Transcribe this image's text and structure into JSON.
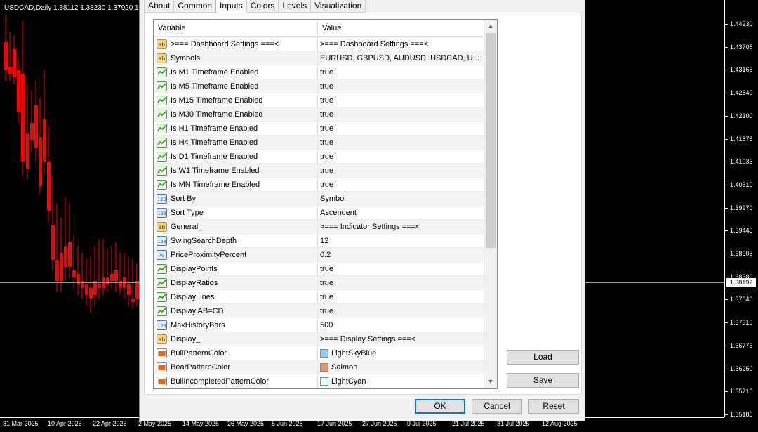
{
  "chart": {
    "header": "USDCAD,Daily  1.38112 1.38230 1.37920 1.",
    "current_price": "1.38192",
    "price_labels": [
      "1.44230",
      "1.43705",
      "1.43165",
      "1.42640",
      "1.42100",
      "1.41575",
      "1.41035",
      "1.40510",
      "1.39970",
      "1.39445",
      "1.38905",
      "1.38380",
      "1.37840",
      "1.37315",
      "1.36775",
      "1.36250",
      "1.35710",
      "1.35185"
    ],
    "date_labels": [
      "31 Mar 2025",
      "10 Apr 2025",
      "22 Apr 2025",
      "2 May 2025",
      "14 May 2025",
      "26 May 2025",
      "5 Jun 2025",
      "17 Jun 2025",
      "27 Jun 2025",
      "9 Jul 2025",
      "21 Jul 2025",
      "31 Jul 2025",
      "12 Aug 2025"
    ],
    "bull_color": "#00ff00",
    "bear_color": "#ff0000"
  },
  "dialog": {
    "tabs": [
      {
        "label": "About"
      },
      {
        "label": "Common"
      },
      {
        "label": "Inputs",
        "active": true
      },
      {
        "label": "Colors"
      },
      {
        "label": "Levels"
      },
      {
        "label": "Visualization"
      }
    ],
    "grid": {
      "columns": {
        "variable": "Variable",
        "value": "Value"
      },
      "rows": [
        {
          "icon": "ab",
          "variable": ">=== Dashboard Settings ===<",
          "value": ">=== Dashboard Settings ===<"
        },
        {
          "icon": "ab",
          "variable": "Symbols",
          "value": "EURUSD, GBPUSD, AUDUSD, USDCAD, U..."
        },
        {
          "icon": "bool",
          "variable": "Is M1 Timeframe Enabled",
          "value": "true"
        },
        {
          "icon": "bool",
          "variable": "Is M5 Timeframe Enabled",
          "value": "true"
        },
        {
          "icon": "bool",
          "variable": "Is M15 Timeframe Enabled",
          "value": "true"
        },
        {
          "icon": "bool",
          "variable": "Is M30 Timeframe Enabled",
          "value": "true"
        },
        {
          "icon": "bool",
          "variable": "Is H1 Timeframe Enabled",
          "value": "true"
        },
        {
          "icon": "bool",
          "variable": "Is H4 Timeframe Enabled",
          "value": "true"
        },
        {
          "icon": "bool",
          "variable": "Is D1 Timeframe Enabled",
          "value": "true"
        },
        {
          "icon": "bool",
          "variable": "Is W1 Timeframe Enabled",
          "value": "true"
        },
        {
          "icon": "bool",
          "variable": "Is MN Timeframe Enabled",
          "value": "true"
        },
        {
          "icon": "int",
          "variable": "Sort By",
          "value": "Symbol"
        },
        {
          "icon": "int",
          "variable": "Sort Type",
          "value": "Ascendent"
        },
        {
          "icon": "ab",
          "variable": "General_",
          "value": ">=== Indicator Settings ===<"
        },
        {
          "icon": "int",
          "variable": "SwingSearchDepth",
          "value": "12"
        },
        {
          "icon": "dbl",
          "variable": "PriceProximityPercent",
          "value": "0.2"
        },
        {
          "icon": "bool",
          "variable": "DisplayPoints",
          "value": "true"
        },
        {
          "icon": "bool",
          "variable": "DisplayRatios",
          "value": "true"
        },
        {
          "icon": "bool",
          "variable": "DisplayLines",
          "value": "true"
        },
        {
          "icon": "bool",
          "variable": "Display AB=CD",
          "value": "true"
        },
        {
          "icon": "int",
          "variable": "MaxHistoryBars",
          "value": "500"
        },
        {
          "icon": "ab",
          "variable": "Display_",
          "value": ">=== Display Settings ===<"
        },
        {
          "icon": "color",
          "variable": "BullPatternColor",
          "value": "LightSkyBlue",
          "swatch": "#87cefa"
        },
        {
          "icon": "color",
          "variable": "BearPatternColor",
          "value": "Salmon",
          "swatch": "#e5955f"
        },
        {
          "icon": "color",
          "variable": "BullIncompletedPatternColor",
          "value": "LightCyan",
          "swatch": "#e0ffff"
        }
      ]
    },
    "buttons": {
      "load": "Load",
      "save": "Save",
      "ok": "OK",
      "cancel": "Cancel",
      "reset": "Reset"
    }
  }
}
